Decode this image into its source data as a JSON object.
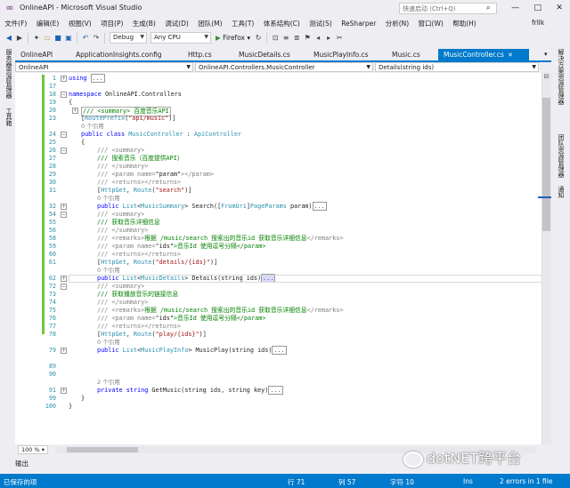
{
  "window": {
    "title": "OnlineAPI - Microsoft Visual Studio",
    "quick_launch_placeholder": "快速启动 (Ctrl+Q)",
    "user": "frllk"
  },
  "menu": [
    "文件(F)",
    "编辑(E)",
    "视图(V)",
    "项目(P)",
    "生成(B)",
    "调试(D)",
    "团队(M)",
    "工具(T)",
    "体系结构(C)",
    "测试(S)",
    "ReSharper",
    "分析(N)",
    "窗口(W)",
    "帮助(H)"
  ],
  "toolbar": {
    "config": "Debug",
    "platform": "Any CPU",
    "run_target": "Firefox"
  },
  "left_strip": [
    "服务器资源管理器",
    "工具箱"
  ],
  "right_strip": [
    "解决方案资源管理器",
    "团队资源管理器",
    "通知"
  ],
  "tabs": [
    "OnlineAPI",
    "ApplicationInsights.config",
    "Http.cs",
    "MusicDetails.cs",
    "MusicPlayInfo.cs",
    "Music.cs",
    "MusicController.cs"
  ],
  "active_tab": "MusicController.cs",
  "nav": {
    "project": "OnlineAPI",
    "type": "OnlineAPI.Controllers.MusicController",
    "member": "Details(string ids)"
  },
  "code": {
    "l1": {
      "n": "1",
      "a": "using",
      "b": "..."
    },
    "l17": {
      "n": "17"
    },
    "l18": {
      "n": "18",
      "a": "namespace",
      "b": "OnlineAPI.Controllers"
    },
    "l19": {
      "n": "19",
      "a": "{"
    },
    "l20": {
      "n": "20",
      "a": "/// <summary> 百度音乐API"
    },
    "l23": {
      "n": "23",
      "a": "RoutePrefix",
      "b": "\"api/music\""
    },
    "l23r": {
      "a": "0 个引用"
    },
    "l24": {
      "n": "24",
      "a": "public class",
      "b": "MusicController",
      "c": "ApiController"
    },
    "l25": {
      "n": "25",
      "a": "{"
    },
    "l26": {
      "n": "26",
      "a": "/// <summary>"
    },
    "l27": {
      "n": "27",
      "a": "/// 搜索音乐（百度提供API）"
    },
    "l28": {
      "n": "28",
      "a": "/// </summary>"
    },
    "l29": {
      "n": "29",
      "a": "/// <param name=",
      "b": "\"param\"",
      "c": "></param>"
    },
    "l30": {
      "n": "30",
      "a": "/// <returns></returns>"
    },
    "l31": {
      "n": "31",
      "a": "HttpGet",
      "b": "Route",
      "c": "\"search\""
    },
    "l31r": {
      "a": "0 个引用"
    },
    "l32": {
      "n": "32",
      "a": "public",
      "b": "List",
      "c": "MusicSummary",
      "d": "Search([",
      "e": "FromUri",
      "f": "PageParams",
      "g": "param)",
      "h": "..."
    },
    "l54": {
      "n": "54",
      "a": "/// <summary>"
    },
    "l55": {
      "n": "55",
      "a": "/// 获取音乐详细信息"
    },
    "l56": {
      "n": "56",
      "a": "/// </summary>"
    },
    "l58": {
      "n": "58",
      "a": "/// <remarks>",
      "b": "根据 /music/search 搜索出的音乐id 获取音乐详细信息",
      "c": "</remarks>"
    },
    "l59": {
      "n": "59",
      "a": "/// <param name=",
      "b": "\"ids\"",
      "c": ">音乐Id 使用逗号分隔</param>"
    },
    "l60": {
      "n": "60",
      "a": "/// <returns></returns>"
    },
    "l61": {
      "n": "61",
      "a": "HttpGet",
      "b": "Route",
      "c": "\"details/{ids}\""
    },
    "l61r": {
      "a": "0 个引用"
    },
    "l62": {
      "n": "62",
      "a": "public",
      "b": "List",
      "c": "MusicDetails",
      "d": "Details(string ids)",
      "e": "..."
    },
    "l72": {
      "n": "72",
      "a": "/// <summary>"
    },
    "l73": {
      "n": "73",
      "a": "/// 获取播放音乐的链接信息"
    },
    "l74": {
      "n": "74",
      "a": "/// </summary>"
    },
    "l75": {
      "n": "75",
      "a": "/// <remarks>",
      "b": "根据 /music/search 搜索出的音乐id 获取音乐详细信息",
      "c": "</remarks>"
    },
    "l76": {
      "n": "76",
      "a": "/// <param name=",
      "b": "\"ids\"",
      "c": ">音乐Id 使用逗号分隔</param>"
    },
    "l77": {
      "n": "77",
      "a": "/// <returns></returns>"
    },
    "l78": {
      "n": "78",
      "a": "HttpGet",
      "b": "Route",
      "c": "\"play/{ids}\""
    },
    "l78r": {
      "a": "0 个引用"
    },
    "l79": {
      "n": "79",
      "a": "public",
      "b": "List",
      "c": "MusicPlayInfo",
      "d": "MusicPlay(string ids)",
      "e": "..."
    },
    "l89": {
      "n": "89"
    },
    "l90": {
      "n": "90"
    },
    "l90r": {
      "a": "2 个引用"
    },
    "l91": {
      "n": "91",
      "a": "private string",
      "b": "GetMusic(string ids, string key)",
      "c": "..."
    },
    "l99": {
      "n": "99",
      "a": "}"
    },
    "l100": {
      "n": "100",
      "a": "}"
    }
  },
  "zoom": "100 %",
  "output_tab": "输出",
  "status": {
    "message": "已保存的项",
    "line": "行 71",
    "col": "列 57",
    "char": "字符 10",
    "ins": "Ins",
    "errors": "2 errors in 1 file"
  },
  "watermark": "dotNET跨平台"
}
